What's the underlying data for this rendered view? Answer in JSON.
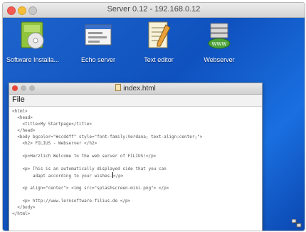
{
  "window": {
    "title": "Server 0.12 - 192.168.0.12"
  },
  "desktop": {
    "icons": [
      {
        "label": "Software Installa...",
        "icon": "software-installer-icon"
      },
      {
        "label": "Echo server",
        "icon": "echo-server-icon"
      },
      {
        "label": "Text editor",
        "icon": "text-editor-icon"
      },
      {
        "label": "Webserver",
        "icon": "webserver-icon"
      }
    ]
  },
  "editor": {
    "title": "index.html",
    "menu": {
      "file": "File"
    },
    "lines": [
      "<html>",
      "  <head>",
      "    <title>My Startpage</title>",
      "  </head>",
      "  <body bgcolor=\"#ccddff\" style=\"font-family:Verdana; text-align:center;\">",
      "    <h2> FILIUS - Webserver </h2>",
      "",
      "    <p>Herzlich Welcome to the web server of FILIUS!</p>",
      "",
      "    <p> This is an automatically displayed side that you can",
      "        adapt according to your wishes.",
      "",
      "    <p align=\"center\"> <img src=\"splashscreen-mini.png\"> </p>",
      "",
      "    <p> http://www.lernsoftware-filius.de </p>",
      "  </body>",
      "</html>"
    ],
    "cursor_line_suffix": "</p>"
  },
  "colors": {
    "desktop": "#1560d0",
    "close": "#f25a52",
    "minimize": "#f7be3a"
  }
}
